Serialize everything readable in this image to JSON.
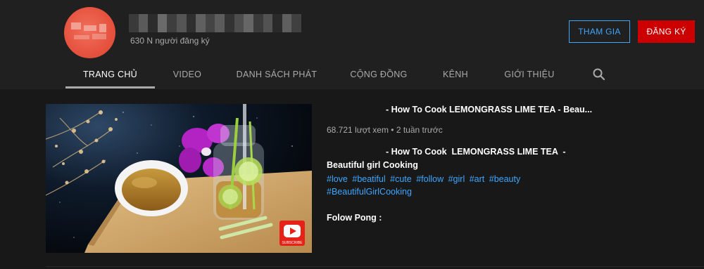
{
  "channel": {
    "subscribers": "630 N người đăng ký"
  },
  "buttons": {
    "join": "THAM GIA",
    "subscribe": "ĐĂNG KÝ"
  },
  "tabs": [
    {
      "label": "TRANG CHỦ",
      "active": true
    },
    {
      "label": "VIDEO"
    },
    {
      "label": "DANH SÁCH PHÁT"
    },
    {
      "label": "CỘNG ĐỒNG"
    },
    {
      "label": "KÊNH"
    },
    {
      "label": "GIỚI THIỆU"
    }
  ],
  "icons": {
    "search": "search-icon",
    "subscribe_badge": "youtube-subscribe-icon"
  },
  "thumbnail": {
    "badge_text": "SUBSCRIBE"
  },
  "video": {
    "title": "- How To Cook LEMONGRASS LIME TEA - Beau...",
    "meta": "68.721 lượt xem • 2 tuần trước",
    "description_line1": "- How To Cook  LEMONGRASS LIME TEA  -",
    "description_line2": "Beautiful girl Cooking",
    "hashtags": [
      "#love",
      "#beatiful",
      "#cute",
      "#follow",
      "#girl",
      "#art",
      "#beauty",
      "#BeautifulGirlCooking"
    ],
    "folow": "Folow Pong :"
  },
  "colors": {
    "background": "#181818",
    "header": "#202020",
    "accent_blue": "#3ea6ff",
    "subscribe_red": "#cc0000"
  }
}
